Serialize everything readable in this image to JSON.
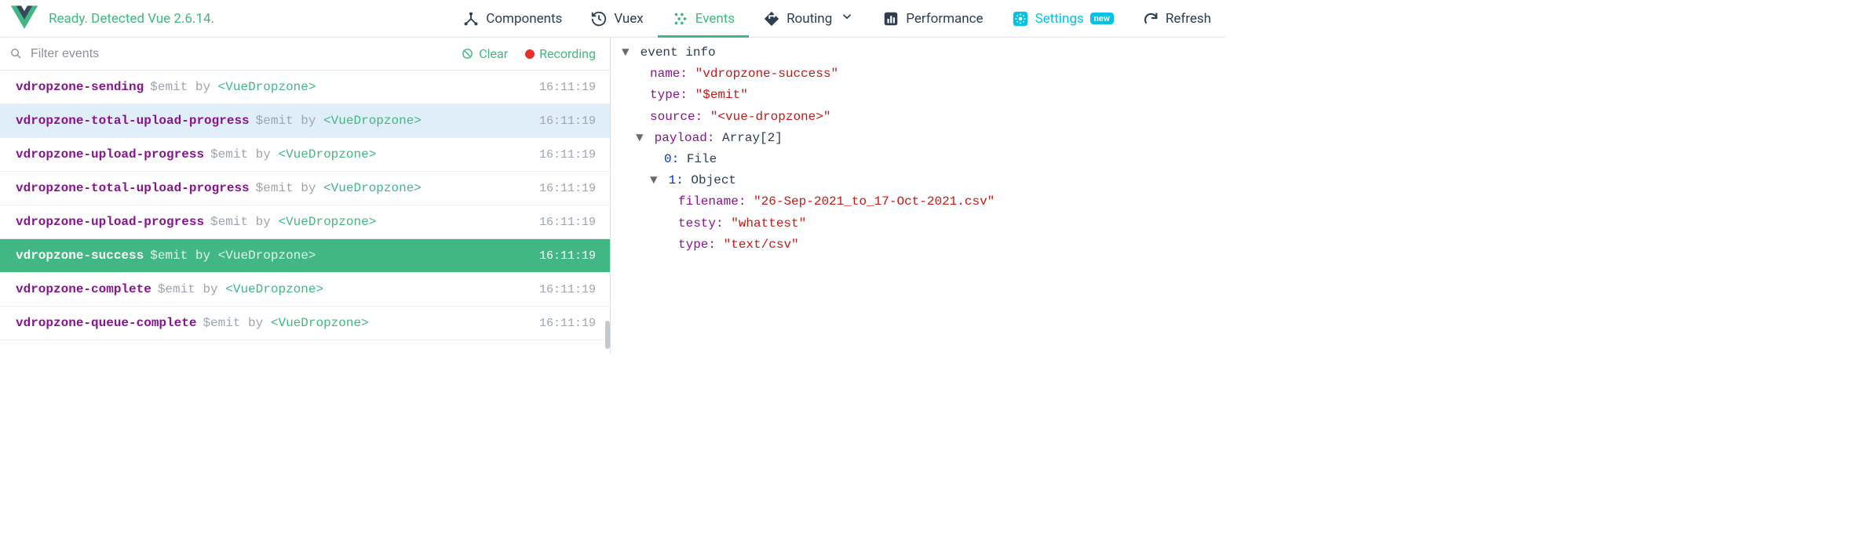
{
  "header": {
    "status": "Ready. Detected Vue 2.6.14.",
    "tabs": {
      "components": "Components",
      "vuex": "Vuex",
      "events": "Events",
      "routing": "Routing",
      "performance": "Performance",
      "settings": "Settings",
      "settings_badge": "new",
      "refresh": "Refresh"
    }
  },
  "left": {
    "filter_placeholder": "Filter events",
    "clear": "Clear",
    "recording": "Recording",
    "events": [
      {
        "name": "vdropzone-sending",
        "emit": "$emit by",
        "component": "<VueDropzone>",
        "time": "16:11:19"
      },
      {
        "name": "vdropzone-total-upload-progress",
        "emit": "$emit by",
        "component": "<VueDropzone>",
        "time": "16:11:19"
      },
      {
        "name": "vdropzone-upload-progress",
        "emit": "$emit by",
        "component": "<VueDropzone>",
        "time": "16:11:19"
      },
      {
        "name": "vdropzone-total-upload-progress",
        "emit": "$emit by",
        "component": "<VueDropzone>",
        "time": "16:11:19"
      },
      {
        "name": "vdropzone-upload-progress",
        "emit": "$emit by",
        "component": "<VueDropzone>",
        "time": "16:11:19"
      },
      {
        "name": "vdropzone-success",
        "emit": "$emit by",
        "component": "<VueDropzone>",
        "time": "16:11:19"
      },
      {
        "name": "vdropzone-complete",
        "emit": "$emit by",
        "component": "<VueDropzone>",
        "time": "16:11:19"
      },
      {
        "name": "vdropzone-queue-complete",
        "emit": "$emit by",
        "component": "<VueDropzone>",
        "time": "16:11:19"
      }
    ]
  },
  "right": {
    "header": "event info",
    "name_key": "name:",
    "name_val": "\"vdropzone-success\"",
    "type_key": "type:",
    "type_val": "\"$emit\"",
    "source_key": "source:",
    "source_val": "\"<vue-dropzone>\"",
    "payload_key": "payload:",
    "payload_val": "Array[2]",
    "idx0_key": "0:",
    "idx0_val": "File",
    "idx1_key": "1:",
    "idx1_val": "Object",
    "obj_filename_key": "filename:",
    "obj_filename_val": "\"26-Sep-2021_to_17-Oct-2021.csv\"",
    "obj_testy_key": "testy:",
    "obj_testy_val": "\"whattest\"",
    "obj_type_key": "type:",
    "obj_type_val": "\"text/csv\""
  }
}
